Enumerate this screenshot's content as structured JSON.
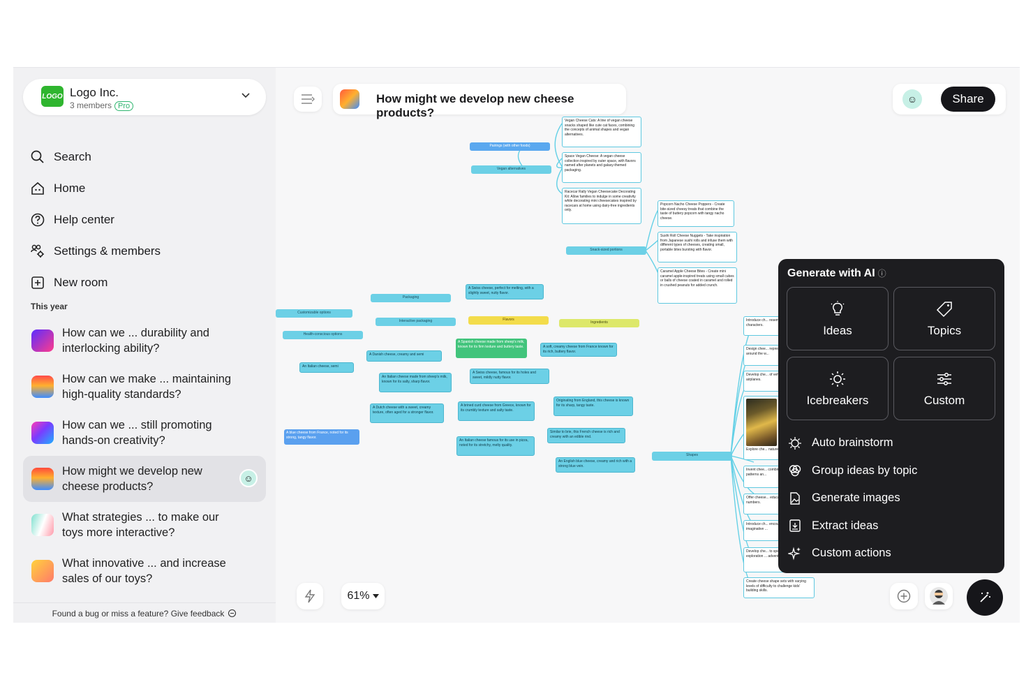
{
  "sidebar": {
    "org": {
      "logo_text": "LOGO",
      "name": "Logo Inc.",
      "members": "3 members",
      "plan": "Pro"
    },
    "nav": [
      {
        "label": "Search",
        "icon": "search-icon"
      },
      {
        "label": "Home",
        "icon": "home-icon"
      },
      {
        "label": "Help center",
        "icon": "help-icon"
      },
      {
        "label": "Settings & members",
        "icon": "settings-members-icon"
      },
      {
        "label": "New room",
        "icon": "new-room-icon"
      }
    ],
    "section_label": "This year",
    "rooms": [
      {
        "title": "How can we ... durability and interlocking ability?",
        "thumb": "#7a3cff"
      },
      {
        "title": "How can we make ... maintaining high-quality standards?",
        "thumb": "#ff7a2f"
      },
      {
        "title": "How can we ... still promoting hands-on creativity?",
        "thumb": "#3d6cff"
      },
      {
        "title": "How might we develop new cheese products?",
        "thumb": "#ff9a2f",
        "active": true
      },
      {
        "title": "What strategies ... to make our toys more interactive?",
        "thumb": "#7fd6c8"
      },
      {
        "title": "What innovative ... and increase sales of our toys?",
        "thumb": "#ffb347"
      }
    ],
    "feedback": "Found a bug or miss a feature? Give feedback"
  },
  "topbar": {
    "title": "How might we develop new cheese products?",
    "share_label": "Share"
  },
  "bottombar": {
    "zoom": "61%"
  },
  "ai_panel": {
    "title": "Generate with AI",
    "tiles": [
      {
        "label": "Ideas",
        "icon": "lightbulb-icon"
      },
      {
        "label": "Topics",
        "icon": "tag-icon"
      },
      {
        "label": "Icebreakers",
        "icon": "sun-icon"
      },
      {
        "label": "Custom",
        "icon": "sliders-icon"
      }
    ],
    "items": [
      {
        "label": "Auto brainstorm",
        "icon": "brainstorm-icon"
      },
      {
        "label": "Group ideas by topic",
        "icon": "group-icon"
      },
      {
        "label": "Generate images",
        "icon": "image-icon"
      },
      {
        "label": "Extract ideas",
        "icon": "extract-icon"
      },
      {
        "label": "Custom actions",
        "icon": "sparkles-icon"
      }
    ]
  },
  "mindmap": {
    "topics": {
      "pairings": "Pairings (with other foods)",
      "vegan": "Vegan alternatives",
      "snack": "Snack-sized portions",
      "packaging": "Packaging",
      "custom": "Customizable options",
      "interactive": "Interactive packaging",
      "flavors": "Flavors",
      "ingredients": "Ingredients",
      "health": "Health-conscious options",
      "shapes": "Shapes"
    },
    "ideas": {
      "vegan_cats": "Vegan Cheese Cats: A line of vegan cheese snacks shaped like cute cat faces, combining the concepts of animal shapes and vegan alternatives.",
      "space_vegan": "Space Vegan Cheese: A vegan cheese collection inspired by outer space, with flavors named after planets and galaxy-themed packaging.",
      "racecar": "Racecar Rally Vegan Cheesecake Decorating Kit: Allow families to indulge in some creativity while decorating mini cheesecakes inspired by racecars at home using dairy-free ingredients only.",
      "popcorn": "Popcorn Nacho Cheese Poppers - Create bite-sized cheesy treats that combine the taste of buttery popcorn with tangy nacho cheese.",
      "sushi": "Sushi Roll Cheese Nuggets - Take inspiration from Japanese sushi rolls and infuse them with different types of cheeses, creating small, portable bites bursting with flavor.",
      "caramel": "Caramel Apple Cheese Bites - Create mini caramel apple-inspired treats using small cubes or balls of cheese coated in caramel and rolled in crushed peanuts for added crunch.",
      "swiss_melt": "A Swiss cheese, perfect for melting, with a slightly sweet, nutty flavor.",
      "danish": "A Danish cheese, creamy and semi",
      "spanish": "A Spanish cheese made from sheep's milk, known for its firm texture and buttery taste.",
      "soft_france": "A soft, creamy cheese from France known for its rich, buttery flavor.",
      "italian_semi": "An Italian cheese, semi",
      "italian_sheep": "An Italian cheese made from sheep's milk, known for its salty, sharp flavor.",
      "swiss_holes": "A Swiss cheese, famous for its holes and sweet, mildly nutty flavor.",
      "dutch": "A Dutch cheese with a sweet, creamy texture, often aged for a stronger flavor.",
      "greece": "A brined curd cheese from Greece, known for its crumbly texture and salty taste.",
      "england": "Originating from England, this cheese is known for its sharp, tangy taste.",
      "blue_france": "A blue cheese from France, noted for its strong, tangy flavor.",
      "pizza": "An Italian cheese famous for its use in pizza, noted for its stretchy, melty quality.",
      "brie": "Similar to brie, this French cheese is rich and creamy with an edible rind.",
      "english_blue": "An English blue cheese, creamy and rich with a strong blue vein.",
      "s1": "Introduce ch... resemble po... characters.",
      "s2": "Design chee... represent fa... around the w...",
      "s3": "Develop che... of vehicles, s... airplanes.",
      "s4": "Explore che... nature, like l...",
      "s5": "Invent chee... combined to... patterns an...",
      "s6": "Offer cheese... educational ... or numbers.",
      "s7": "Introduce ch... encourage s... imaginative ...",
      "s8": "Develop che... to specific th... exploration ... adventures.",
      "s9": "Create cheese shape sets with varying levels of difficulty to challenge kids' building skills."
    }
  }
}
